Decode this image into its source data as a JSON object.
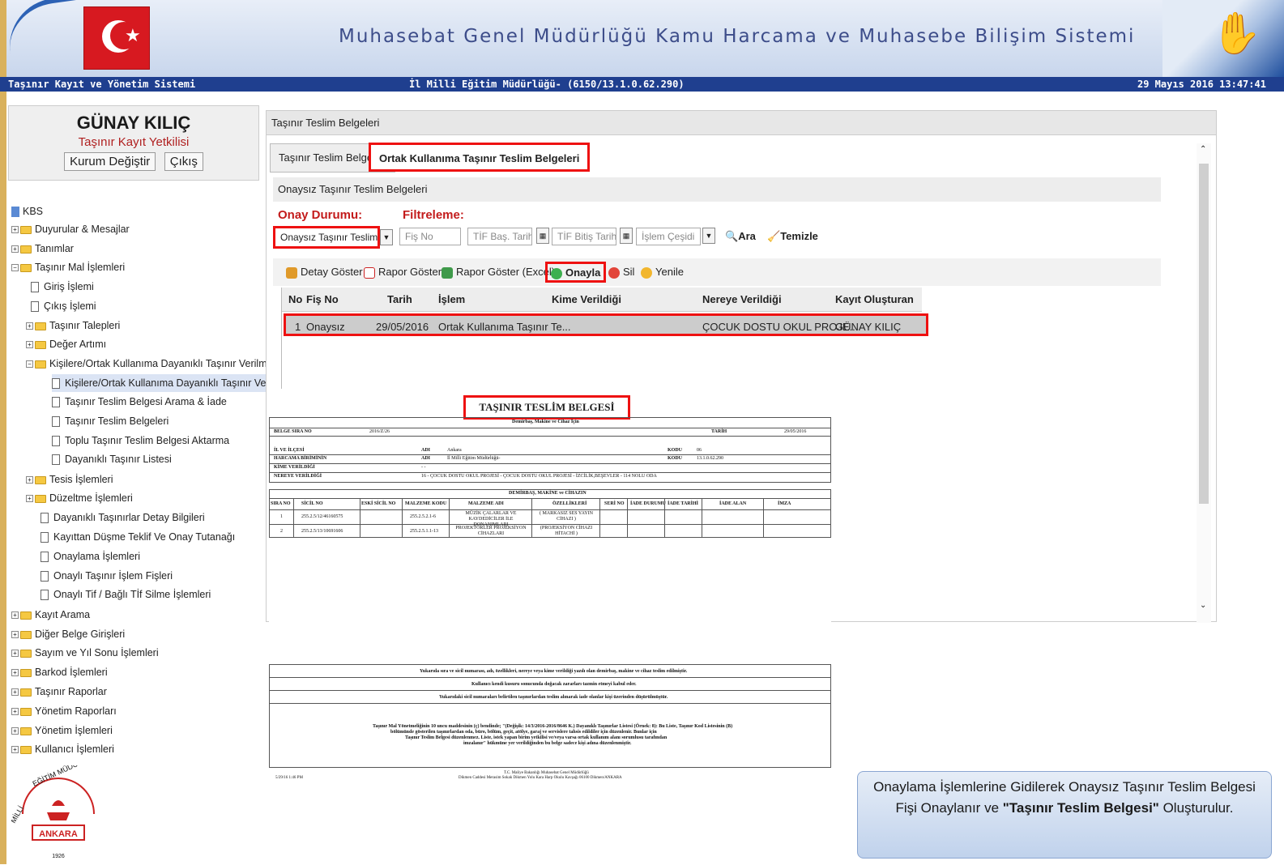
{
  "header": {
    "title": "Muhasebat Genel Müdürlüğü Kamu Harcama ve Muhasebe Bilişim Sistemi",
    "left": "Taşınır Kayıt ve Yönetim Sistemi",
    "center": "İl Milli Eğitim Müdürlüğü- (6150/13.1.0.62.290)",
    "right": "29 Mayıs 2016 13:47:41"
  },
  "user": {
    "name": "GÜNAY KILIÇ",
    "role": "Taşınır Kayıt Yetkilisi",
    "btn_kurum": "Kurum Değiştir",
    "btn_cikis": "Çıkış"
  },
  "tree": [
    "KBS",
    "Duyurular & Mesajlar",
    "Tanımlar",
    "Taşınır Mal İşlemleri",
    "Giriş İşlemi",
    "Çıkış İşlemi",
    "Taşınır Talepleri",
    "Değer Artımı",
    "Kişilere/Ortak Kullanıma Dayanıklı Taşınır Verilmesi İşlemleri",
    "Kişilere/Ortak Kullanıma Dayanıklı Taşınır Verme",
    "Taşınır Teslim Belgesi Arama & İade",
    "Taşınır Teslim Belgeleri",
    "Toplu Taşınır Teslim Belgesi Aktarma",
    "Dayanıklı Taşınır Listesi",
    "Tesis İşlemleri",
    "Düzeltme İşlemleri",
    "Dayanıklı Taşınırlar Detay Bilgileri",
    "Kayıttan Düşme Teklif Ve Onay Tutanağı",
    "Onaylama İşlemleri",
    "Onaylı Taşınır İşlem Fişleri",
    "Onaylı Tif / Bağlı Tİf Silme İşlemleri",
    "Kayıt Arama",
    "Diğer Belge Girişleri",
    "Sayım ve Yıl Sonu İşlemleri",
    "Barkod İşlemleri",
    "Taşınır Raporlar",
    "Yönetim Raporları",
    "Yönetim İşlemleri",
    "Kullanıcı İşlemleri"
  ],
  "panel": {
    "title": "Taşınır Teslim Belgeleri",
    "tab1": "Taşınır Teslim Belgeleri",
    "tab2": "Ortak Kullanıma Taşınır Teslim Belgeleri",
    "sub": "Onaysız Taşınır Teslim Belgeleri",
    "onay_label": "Onay Durumu:",
    "filtre_label": "Filtreleme:",
    "onay_value": "Onaysız Taşınır Teslim Be",
    "fis_ph": "Fiş No",
    "bas_ph": "TİF Baş. Tarihi",
    "bit_ph": "TİF Bitiş Tarihi",
    "islem_ph": "İşlem Çeşidi",
    "ara": "Ara",
    "temizle": "Temizle"
  },
  "toolbar": {
    "detay": "Detay Göster",
    "rapor": "Rapor Göster",
    "excel": "Rapor Göster (Excel)",
    "onayla": "Onayla",
    "sil": "Sil",
    "yenile": "Yenile"
  },
  "grid": {
    "headers": [
      "No",
      "Fiş No",
      "Tarih",
      "İşlem",
      "Kime Verildiği",
      "Nereye Verildiği",
      "Kayıt Oluşturan"
    ],
    "row": [
      "1",
      "Onaysız",
      "29/05/2016",
      "Ortak Kullanıma Taşınır Te...",
      "",
      "ÇOCUK DOSTU OKUL PROJE...",
      "GÜNAY KILIÇ"
    ]
  },
  "doc": {
    "title": "TAŞINIR TESLİM BELGESİ",
    "sub": "Demirbaş, Makine ve Cihaz İçin",
    "belge_sira": "BELGE SIRA NO",
    "belge_val": "2016/Z/26",
    "tarih": "TARİH",
    "tarih_val": "29/05/2016",
    "il": "İL VE İLÇESİ",
    "adi": "ADI",
    "il_val": "Ankara",
    "kodu": "KODU",
    "il_kod": "06",
    "harcama": "HARCAMA BİRİMİNİN",
    "harcama_val": "İl Milli Eğitim Müdürlüğü-",
    "harcama_kod": "13.1.0.62.290",
    "kime": "KİME VERİLDİĞİ",
    "kime_val": "- -",
    "nereye": "NEREYE VERİLDİĞİ",
    "nereye_val": "16 - ÇOCUK DOSTU OKUL PROJESİ - ÇOCUK DOSTU OKUL PROJESİ - İZCİLİK,BEŞEVLER - 114 NOLU ODA",
    "section": "DEMİRBAŞ, MAKİNE ve CİHAZIN",
    "cols": [
      "SIRA NO",
      "SİCİL NO",
      "ESKİ SİCİL NO",
      "MALZEME KODU",
      "MALZEME ADI",
      "ÖZELLİKLERİ",
      "SERİ NO",
      "İADE DURUMU",
      "İADE TARİHİ",
      "İADE ALAN",
      "İMZA"
    ],
    "rows": [
      [
        "1",
        "255.2.5/12/46160575",
        "",
        "255.2.5.2.1-6",
        "MÜZİK ÇALARLAR VE KAYDEDİCİLER İLE DONANIMLARI",
        "( MARKASIZ SES YAYIN CİHAZI )"
      ],
      [
        "2",
        "255.2.5/13/10691606",
        "",
        "255.2.5.1.1-13",
        "PROJEKTÖRLER PROJEKSİYON CİHAZLARI",
        "(PROJEKSİYON CİHAZI HİTACHİ )"
      ]
    ],
    "f1": "Yukarıda sıra ve sicil numarası, adı, özellikleri, nereye veya kime verildiği yazılı olan demirbaş, makine ve cihaz teslim edilmiştir.",
    "f2": "Kullanıcı kendi kusuru sonucunda doğacak zararları tazmin etmeyi kabul eder.",
    "f3": "Yukarıdaki sicil numaraları belirtilen taşınırlardan teslim alınarak iade olanlar kişi üzerinden düşürülmüştür.",
    "f4": "Taşınır Mal Yönetmeliğinin 10 uncu maddesinin (ç) bendinde; \"(Değişik: 14/3/2016-2016/8646 K.) Dayanıklı Taşınırlar Listesi (Örnek: 8): Bu Liste, Taşınır Kod Listesinin (B)",
    "f5": "bölümünde gösterilen taşınırlardan oda, büro, bölüm, geçit, atölye, garaj ve servislere tahsis edildiler için düzenlenir. Bunlar için",
    "f6": "Taşınır Teslim Belgesi düzenlenmez. Liste, istek yapan birim yetkilisi ve/veya varsa ortak kullanım alanı sorumlusu tarafından",
    "f7": "imzalanır\" hükmüne yer verildiğinden bu belge sadece kişi adına düzenlenmiştir.",
    "print": "5/29/16 1:46 PM",
    "addr1": "T.C. Maliye Bakanlığı Muhasebat Genel Müdürlüğü",
    "addr2": "Dikmen Caddesi Merasim Sokak Dikmen Yolu Kara Harp Okulu Kavşağı 06100 Dikmen/ANKARA"
  },
  "note": {
    "t1": "Onaylama İşlemlerine Gidilerek Onaysız Taşınır Teslim Belgesi Fişi Onaylanır ve ",
    "t2": "\"Taşınır Teslim Belgesi\"",
    "t3": " Oluşturulur."
  },
  "logo": {
    "top": "EĞİTİM MÜDÜRLÜĞÜ",
    "city": "ANKARA",
    "left": "MİLLİ",
    "year": "1926"
  }
}
